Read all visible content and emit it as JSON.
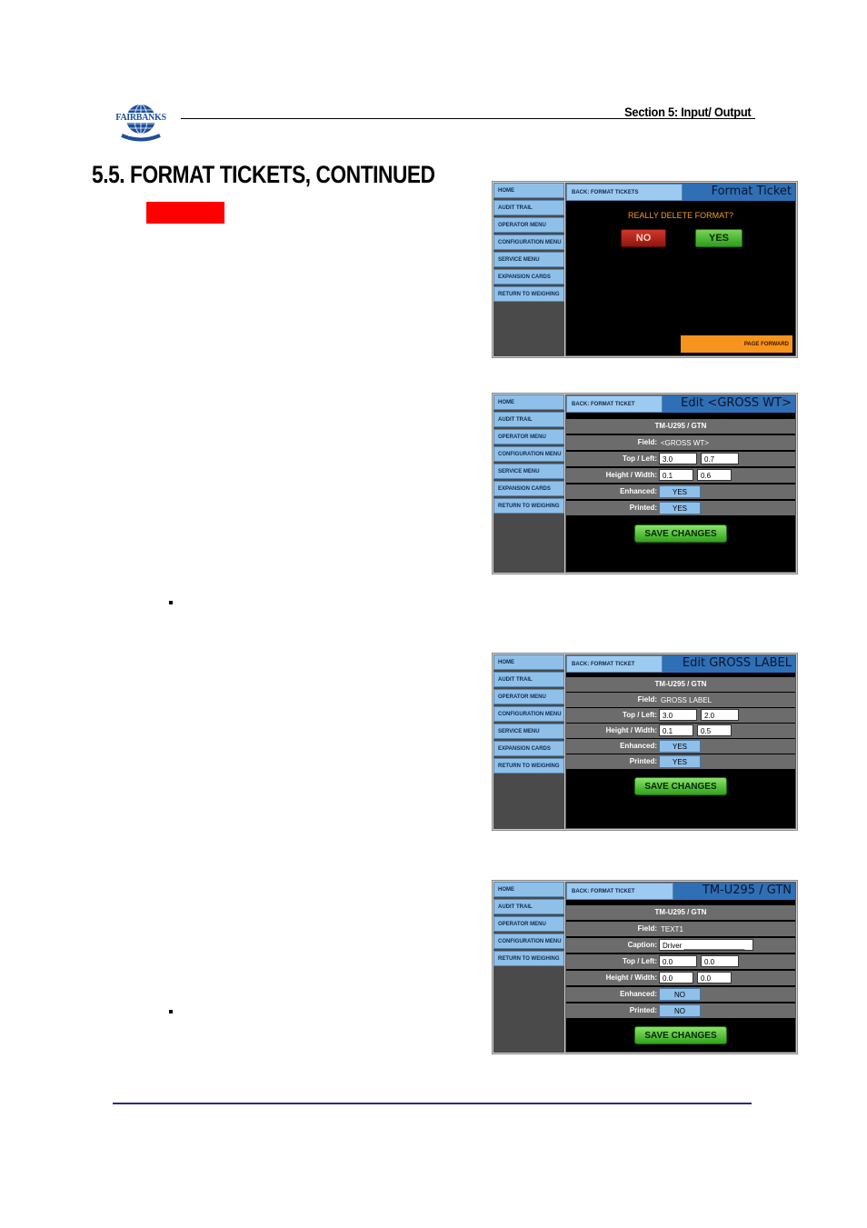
{
  "header": {
    "logo_text": "FAIRBANKS",
    "logo_subtext": "SCALES",
    "section_label": "Section 5: Input/ Output",
    "page_heading": "5.5.  FORMAT TICKETS, CONTINUED"
  },
  "colors": {
    "accent_blue": "#2f6fb5",
    "menu_blue": "#8fc0ea",
    "flag_red": "#ff0000",
    "save_green": "#2fa31a",
    "page_forward_orange": "#f7941d"
  },
  "screens": [
    {
      "menu": [
        "HOME",
        "AUDIT TRAIL",
        "OPERATOR MENU",
        "CONFIGURATION MENU",
        "SERVICE MENU",
        "EXPANSION CARDS",
        "RETURN TO WEIGHING"
      ],
      "back": "BACK: FORMAT TICKETS",
      "title": "Format Ticket",
      "prompt": "REALLY DELETE FORMAT?",
      "no_label": "NO",
      "yes_label": "YES",
      "page_forward": "PAGE FORWARD"
    },
    {
      "menu": [
        "HOME",
        "AUDIT TRAIL",
        "OPERATOR MENU",
        "CONFIGURATION MENU",
        "SERVICE MENU",
        "EXPANSION CARDS",
        "RETURN TO WEIGHING"
      ],
      "back": "BACK: FORMAT TICKET",
      "title": "Edit <GROSS WT>",
      "ticket": "TM-U295 / GTN",
      "field_label": "Field:",
      "field_value": "<GROSS WT>",
      "topleft_label": "Top / Left:",
      "top": "3.0",
      "left": "0.7",
      "hw_label": "Height / Width:",
      "height": "0.1",
      "width": "0.6",
      "enh_label": "Enhanced:",
      "enh": "YES",
      "print_label": "Printed:",
      "printed": "YES",
      "save": "SAVE CHANGES"
    },
    {
      "menu": [
        "HOME",
        "AUDIT TRAIL",
        "OPERATOR MENU",
        "CONFIGURATION MENU",
        "SERVICE MENU",
        "EXPANSION CARDS",
        "RETURN TO WEIGHING"
      ],
      "back": "BACK: FORMAT TICKET",
      "title": "Edit GROSS LABEL",
      "ticket": "TM-U295 / GTN",
      "field_label": "Field:",
      "field_value": "GROSS LABEL",
      "topleft_label": "Top / Left:",
      "top": "3.0",
      "left": "2.0",
      "hw_label": "Height / Width:",
      "height": "0.1",
      "width": "0.5",
      "enh_label": "Enhanced:",
      "enh": "YES",
      "print_label": "Printed:",
      "printed": "YES",
      "save": "SAVE CHANGES"
    },
    {
      "menu": [
        "HOME",
        "AUDIT TRAIL",
        "OPERATOR MENU",
        "CONFIGURATION MENU",
        "RETURN TO WEIGHING"
      ],
      "back": "BACK: FORMAT TICKET",
      "title": "TM-U295 / GTN",
      "ticket": "TM-U295 / GTN",
      "field_label": "Field:",
      "field_value": "TEXT1",
      "caption_label": "Caption:",
      "caption": "Driver _______________",
      "topleft_label": "Top / Left:",
      "top": "0.0",
      "left": "0.0",
      "hw_label": "Height / Width:",
      "height": "0.0",
      "width": "0.0",
      "enh_label": "Enhanced:",
      "enh": "NO",
      "print_label": "Printed:",
      "printed": "NO",
      "save": "SAVE CHANGES"
    }
  ]
}
